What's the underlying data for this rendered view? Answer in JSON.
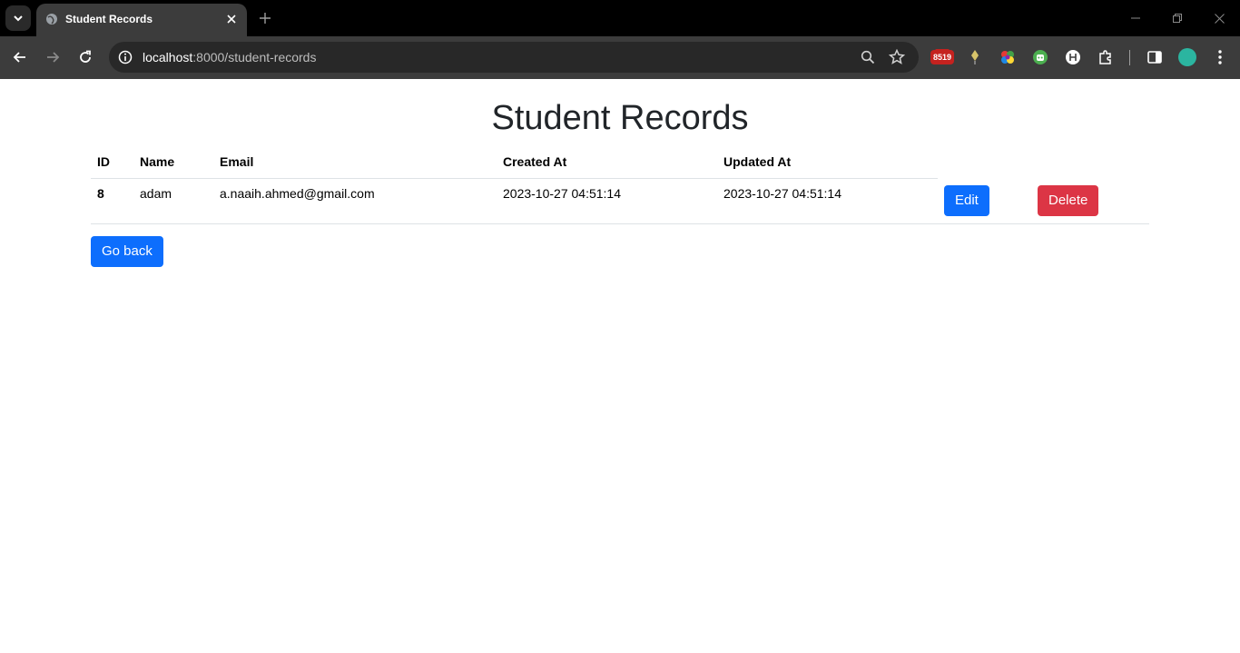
{
  "browser": {
    "tab": {
      "title": "Student Records"
    },
    "address": {
      "host": "localhost",
      "path": ":8000/student-records"
    },
    "extension_badge": "8519",
    "colors": {
      "profile": "#2bb5a0",
      "badge": "#c5221f"
    }
  },
  "page": {
    "title": "Student Records",
    "table": {
      "headers": {
        "id": "ID",
        "name": "Name",
        "email": "Email",
        "created": "Created At",
        "updated": "Updated At"
      },
      "rows": [
        {
          "id": "8",
          "name": "adam",
          "email": "a.naaih.ahmed@gmail.com",
          "created": "2023-10-27 04:51:14",
          "updated": "2023-10-27 04:51:14",
          "edit_label": "Edit",
          "delete_label": "Delete"
        }
      ]
    },
    "go_back_label": "Go back",
    "colors": {
      "primary": "#0d6efd",
      "danger": "#dc3545",
      "title": "#212529"
    }
  }
}
